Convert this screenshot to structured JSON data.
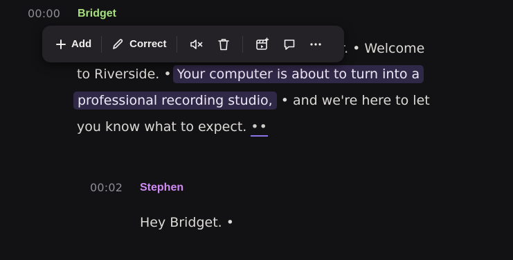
{
  "transcript": {
    "segments": [
      {
        "timestamp": "00:00",
        "speaker": "Bridget",
        "speaker_color": "#a7e17d",
        "line1_tail": "r. • Welcome",
        "line2_plain": "to Riverside. •",
        "line2_highlight": "Your computer is about to turn into a",
        "line3_highlight": "professional recording studio,",
        "line3_plain": "• and we're here to let",
        "line4_plain": "you know what to expect.",
        "line4_pause": "••"
      },
      {
        "timestamp": "00:02",
        "speaker": "Stephen",
        "speaker_color": "#d08bf6",
        "text": "Hey Bridget. •"
      }
    ]
  },
  "toolbar": {
    "add_label": "Add",
    "correct_label": "Correct",
    "icons": [
      "plus-icon",
      "pencil-icon",
      "mute-icon",
      "trash-icon",
      "clip-icon",
      "comment-icon",
      "more-icon"
    ]
  },
  "colors": {
    "background": "#121113",
    "highlight": "#302847",
    "toolbar_bg": "#242227",
    "pause_underline": "#8a74e6"
  }
}
